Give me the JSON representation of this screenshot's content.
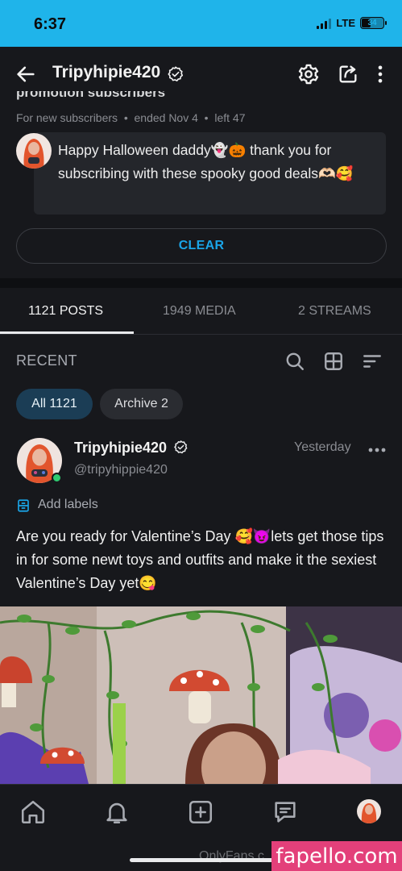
{
  "status_bar": {
    "time": "6:37",
    "network": "LTE",
    "battery": "34"
  },
  "header": {
    "title": "Tripyhipie420"
  },
  "promotion": {
    "title": "promotion subscribers",
    "meta": "For new subscribers  •  ended Nov 4  •  left 47",
    "message": "Happy Halloween daddy👻🎃 thank you for subscribing with these spooky good deals🫶🏻🥰",
    "clear_label": "CLEAR"
  },
  "tabs": [
    {
      "label": "1121 POSTS",
      "active": true
    },
    {
      "label": "1949 MEDIA",
      "active": false
    },
    {
      "label": "2 STREAMS",
      "active": false
    }
  ],
  "feed": {
    "section_title": "RECENT",
    "chips": [
      {
        "label": "All 1121",
        "active": true
      },
      {
        "label": "Archive 2",
        "active": false
      }
    ]
  },
  "post": {
    "author": "Tripyhipie420",
    "handle": "@tripyhippie420",
    "time": "Yesterday",
    "add_labels": "Add labels",
    "text": "Are you ready for Valentine’s Day 🥰😈lets get those tips in for some newt toys and outfits and make it the sexiest Valentine’s Day yet😋"
  },
  "watermarks": {
    "of": "OnlyFans.c",
    "site": "fapello.com"
  },
  "colors": {
    "status_bar": "#1fb4ea",
    "accent": "#1aa5e8",
    "background": "#17181c",
    "chip_active": "#1b3d55",
    "online": "#2ecc71",
    "watermark": "#e3407a"
  },
  "icons": [
    "back-arrow-icon",
    "verified-icon",
    "gear-icon",
    "share-icon",
    "more-vertical-icon",
    "search-icon",
    "grid-icon",
    "sort-icon",
    "more-horizontal-icon",
    "label-icon",
    "home-icon",
    "bell-icon",
    "add-square-icon",
    "message-icon"
  ]
}
